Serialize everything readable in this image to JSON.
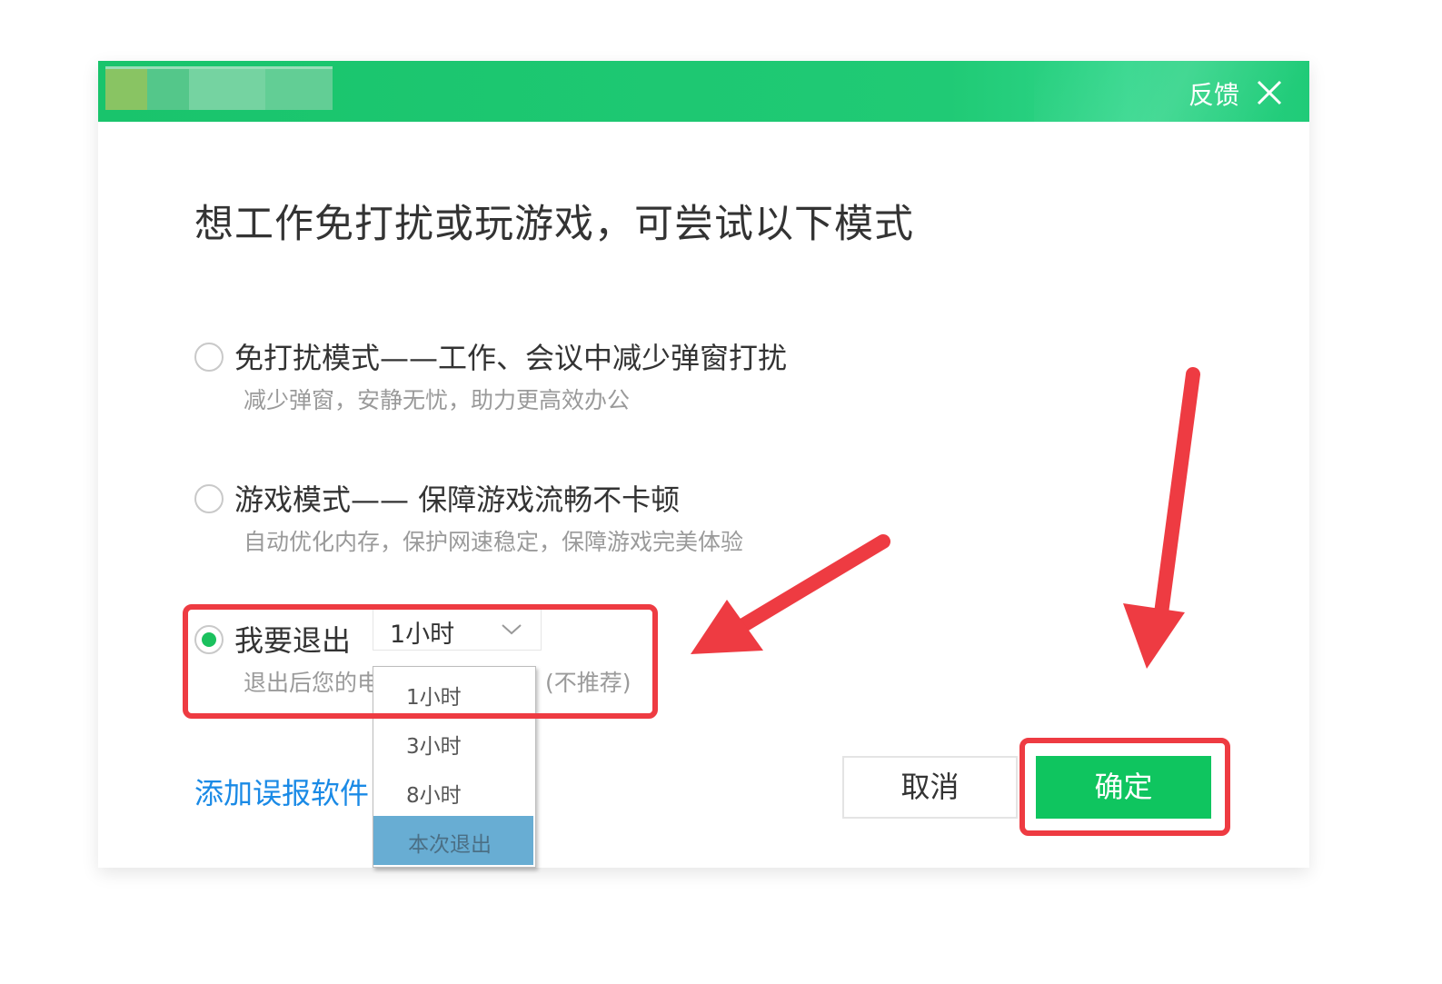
{
  "header": {
    "feedback": "反馈"
  },
  "headline": "想工作免打扰或玩游戏，可尝试以下模式",
  "options": [
    {
      "title": "免打扰模式——工作、会议中减少弹窗打扰",
      "subtitle": "减少弹窗，安静无忧，助力更高效办公",
      "checked": false
    },
    {
      "title": "游戏模式—— 保障游戏流畅不卡顿",
      "subtitle": "自动优化内存，保护网速稳定，保障游戏完美体验",
      "checked": false
    },
    {
      "title": "我要退出",
      "subtitle_left": "退出后您的电",
      "subtitle_right": "(不推荐)",
      "checked": true
    }
  ],
  "select": {
    "value": "1小时"
  },
  "dropdown": [
    "1小时",
    "3小时",
    "8小时",
    "本次退出"
  ],
  "dropdown_highlighted": "本次退出",
  "footer": {
    "link": "添加误报软件",
    "cancel": "取消",
    "ok": "确定"
  },
  "colors": {
    "header_green": "#20ca75",
    "primary_green": "#0fc55f",
    "link_blue": "#1a8ae6",
    "annotation_red": "#ee3b42",
    "dropdown_selected": "#68add3"
  }
}
